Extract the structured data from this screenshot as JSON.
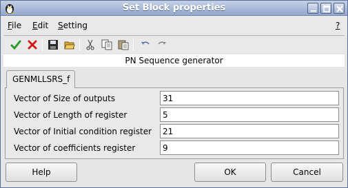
{
  "window": {
    "title": "Set Block properties"
  },
  "menu": {
    "file": "File",
    "edit": "Edit",
    "setting": "Setting",
    "help": "?"
  },
  "toolbar": {
    "icons": [
      "ok-check-icon",
      "cancel-x-icon",
      "save-icon",
      "open-folder-icon",
      "cut-icon",
      "copy-icon",
      "paste-icon",
      "undo-icon",
      "redo-icon"
    ]
  },
  "block": {
    "description": "PN Sequence generator"
  },
  "tab": {
    "label": "GENMLLSRS_f"
  },
  "params": [
    {
      "label": "Vector of Size of outputs",
      "value": "31"
    },
    {
      "label": "Vector of Length of register",
      "value": "5"
    },
    {
      "label": "Vector of Initial condition register",
      "value": "21"
    },
    {
      "label": "Vector of coefficients register",
      "value": "9"
    }
  ],
  "buttons": {
    "help": "Help",
    "ok": "OK",
    "cancel": "Cancel"
  },
  "colors": {
    "titlebar": "#93a8cd",
    "ok_green": "#2e9a2e",
    "cancel_red": "#d01818"
  }
}
